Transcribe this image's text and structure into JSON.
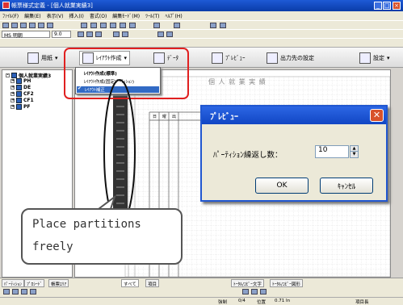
{
  "window": {
    "title": "帳票様式定義 - [個人就業実績3]",
    "minimize": "_",
    "maximize": "□",
    "close": "×"
  },
  "menubar": [
    "ﾌｧｲﾙ(F)",
    "編集(E)",
    "表示(V)",
    "挿入(I)",
    "書式(O)",
    "編集ﾓｰﾄﾞ(M)",
    "ﾂｰﾙ(T)",
    "ﾍﾙﾌﾟ(H)"
  ],
  "toolbar2": {
    "font_name": "MS 明朝",
    "font_size": "9.0"
  },
  "ribbon": {
    "attr": "用紙",
    "layout": "ﾚｲｱｳﾄ作成",
    "data": "ﾃﾞｰﾀ",
    "preview": "ﾌﾟﾚﾋﾞｭｰ",
    "output": "出力先の設定",
    "settings": "設定"
  },
  "dropdown": {
    "items": [
      "ﾚｲｱｳﾄ作成(標準)",
      "ﾚｲｱｳﾄ作成(固定ﾊﾟｰﾃｨｼｮﾝ)",
      "ﾚｲｱｳﾄ補正"
    ]
  },
  "tree": {
    "root": "個人就業実績3",
    "children": [
      "PH",
      "DE",
      "CF2",
      "CF1",
      "PF"
    ]
  },
  "canvas": {
    "page_title": "個 人 就 業 実 績",
    "col_headers": [
      "日",
      "曜",
      "出"
    ]
  },
  "dialog": {
    "title": "ﾌﾟﾚﾋﾞｭｰ",
    "label": "ﾊﾟｰﾃｨｼｮﾝ繰返し数：",
    "value": "10",
    "ok": "OK",
    "cancel": "ｷｬﾝｾﾙ"
  },
  "callout": {
    "line1": "Place partitions",
    "line2": "freely"
  },
  "bottom_tabs": [
    "ﾊﾟｰﾃｨｼｮﾝ",
    "ﾌﾟﾛｼｰﾄﾞ",
    "帳票ｴﾘｱ",
    "すべて",
    "項目",
    "ﾄｰﾀﾙ/ｺﾋﾟｰ文字",
    "ﾄｰﾀﾙ/ｺﾋﾟｰ図形"
  ],
  "statusbar": {
    "mode": "強制",
    "col": "0/4",
    "pos": "位置",
    "zoom": "0.71 In",
    "item": "項目長"
  },
  "colors": {
    "title_bar": "#0a3ca8",
    "highlight_red": "#e02020",
    "selection": "#316ac5"
  }
}
